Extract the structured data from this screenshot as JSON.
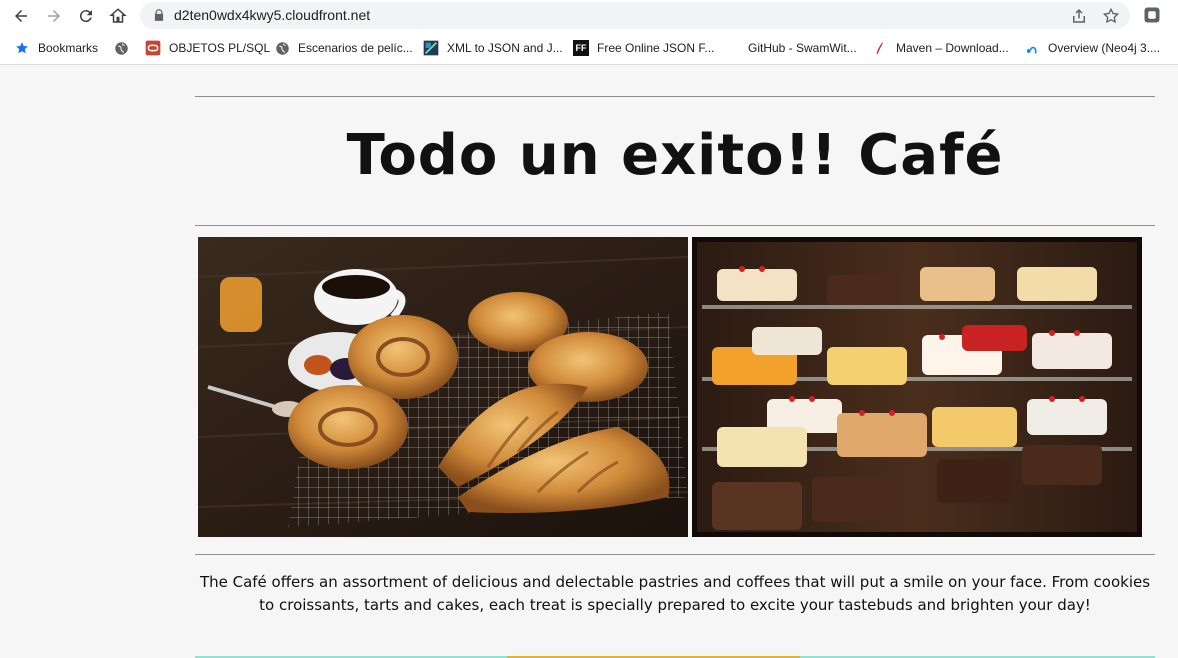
{
  "browser": {
    "url": "d2ten0wdx4kwy5.cloudfront.net",
    "bookmarks": [
      {
        "label": "Bookmarks",
        "icon": "star-icon"
      },
      {
        "label": "",
        "icon": "globe-icon"
      },
      {
        "label": "OBJETOS PL/SQL",
        "icon": "oracle-icon"
      },
      {
        "label": "Escenarios de pelíc...",
        "icon": "globe-icon"
      },
      {
        "label": "XML to JSON and J...",
        "icon": "xml-json-icon"
      },
      {
        "label": "Free Online JSON F...",
        "icon": "ff-icon"
      },
      {
        "label": "GitHub - SwamWit...",
        "icon": "github-icon"
      },
      {
        "label": "Maven – Download...",
        "icon": "maven-icon"
      },
      {
        "label": "Overview (Neo4j 3....",
        "icon": "neo4j-icon"
      }
    ],
    "ff_icon_text": "FF"
  },
  "site": {
    "title": "Todo un exito!! Café",
    "description": "The Café offers an assortment of delicious and delectable pastries and coffees that will put a smile on your face. From cookies to croissants, tarts and cakes, each treat is specially prepared to excite your tastebuds and brighten your day!"
  },
  "colors": {
    "page_bg": "#f6f6f6",
    "rule": "#8c8c8c",
    "strip_teal": "#8fe3d0",
    "strip_gold": "#e0b43c"
  }
}
